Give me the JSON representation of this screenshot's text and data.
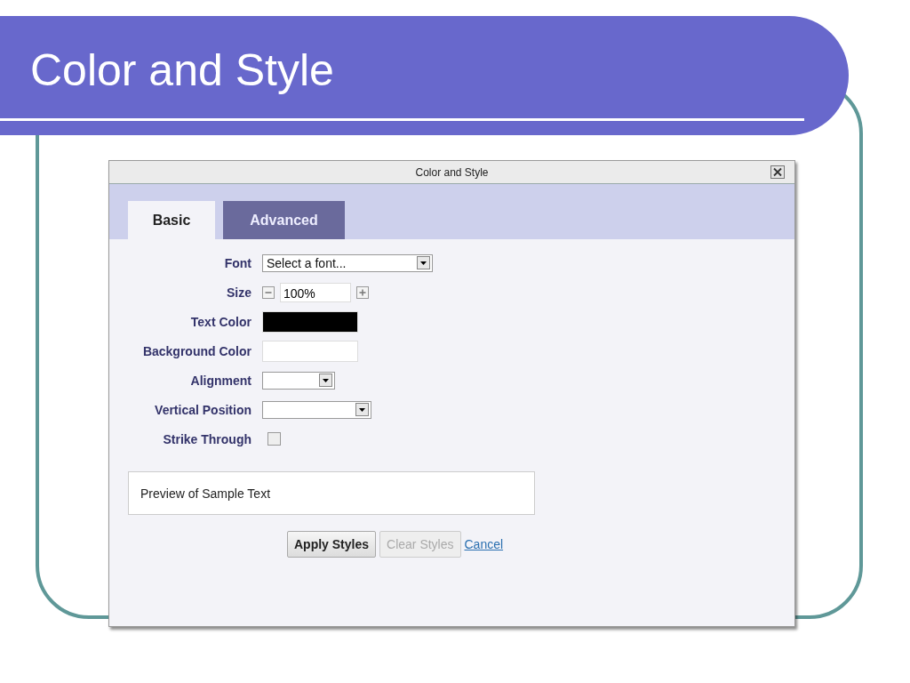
{
  "slide": {
    "title": "Color and Style"
  },
  "dialog": {
    "title": "Color and Style",
    "tabs": [
      {
        "label": "Basic",
        "selected": true
      },
      {
        "label": "Advanced",
        "selected": false
      }
    ],
    "fields": [
      {
        "kind": "select",
        "label": "Font",
        "value": "Select a font..."
      },
      {
        "kind": "stepper",
        "label": "Size",
        "value": "100%"
      },
      {
        "kind": "color",
        "label": "Text Color",
        "color": "#000000"
      },
      {
        "kind": "color",
        "label": "Background Color",
        "color": "#ffffff"
      },
      {
        "kind": "select",
        "label": "Alignment"
      },
      {
        "kind": "select",
        "label": "Vertical Position"
      },
      {
        "kind": "checkbox",
        "label": "Strike Through",
        "checked": false
      }
    ],
    "preview": "Preview of Sample Text",
    "buttons": [
      {
        "kind": "button",
        "label": "Apply Styles",
        "disabled": false
      },
      {
        "kind": "button",
        "label": "Clear Styles",
        "disabled": true
      },
      {
        "kind": "link",
        "label": "Cancel",
        "disabled": false
      }
    ]
  }
}
